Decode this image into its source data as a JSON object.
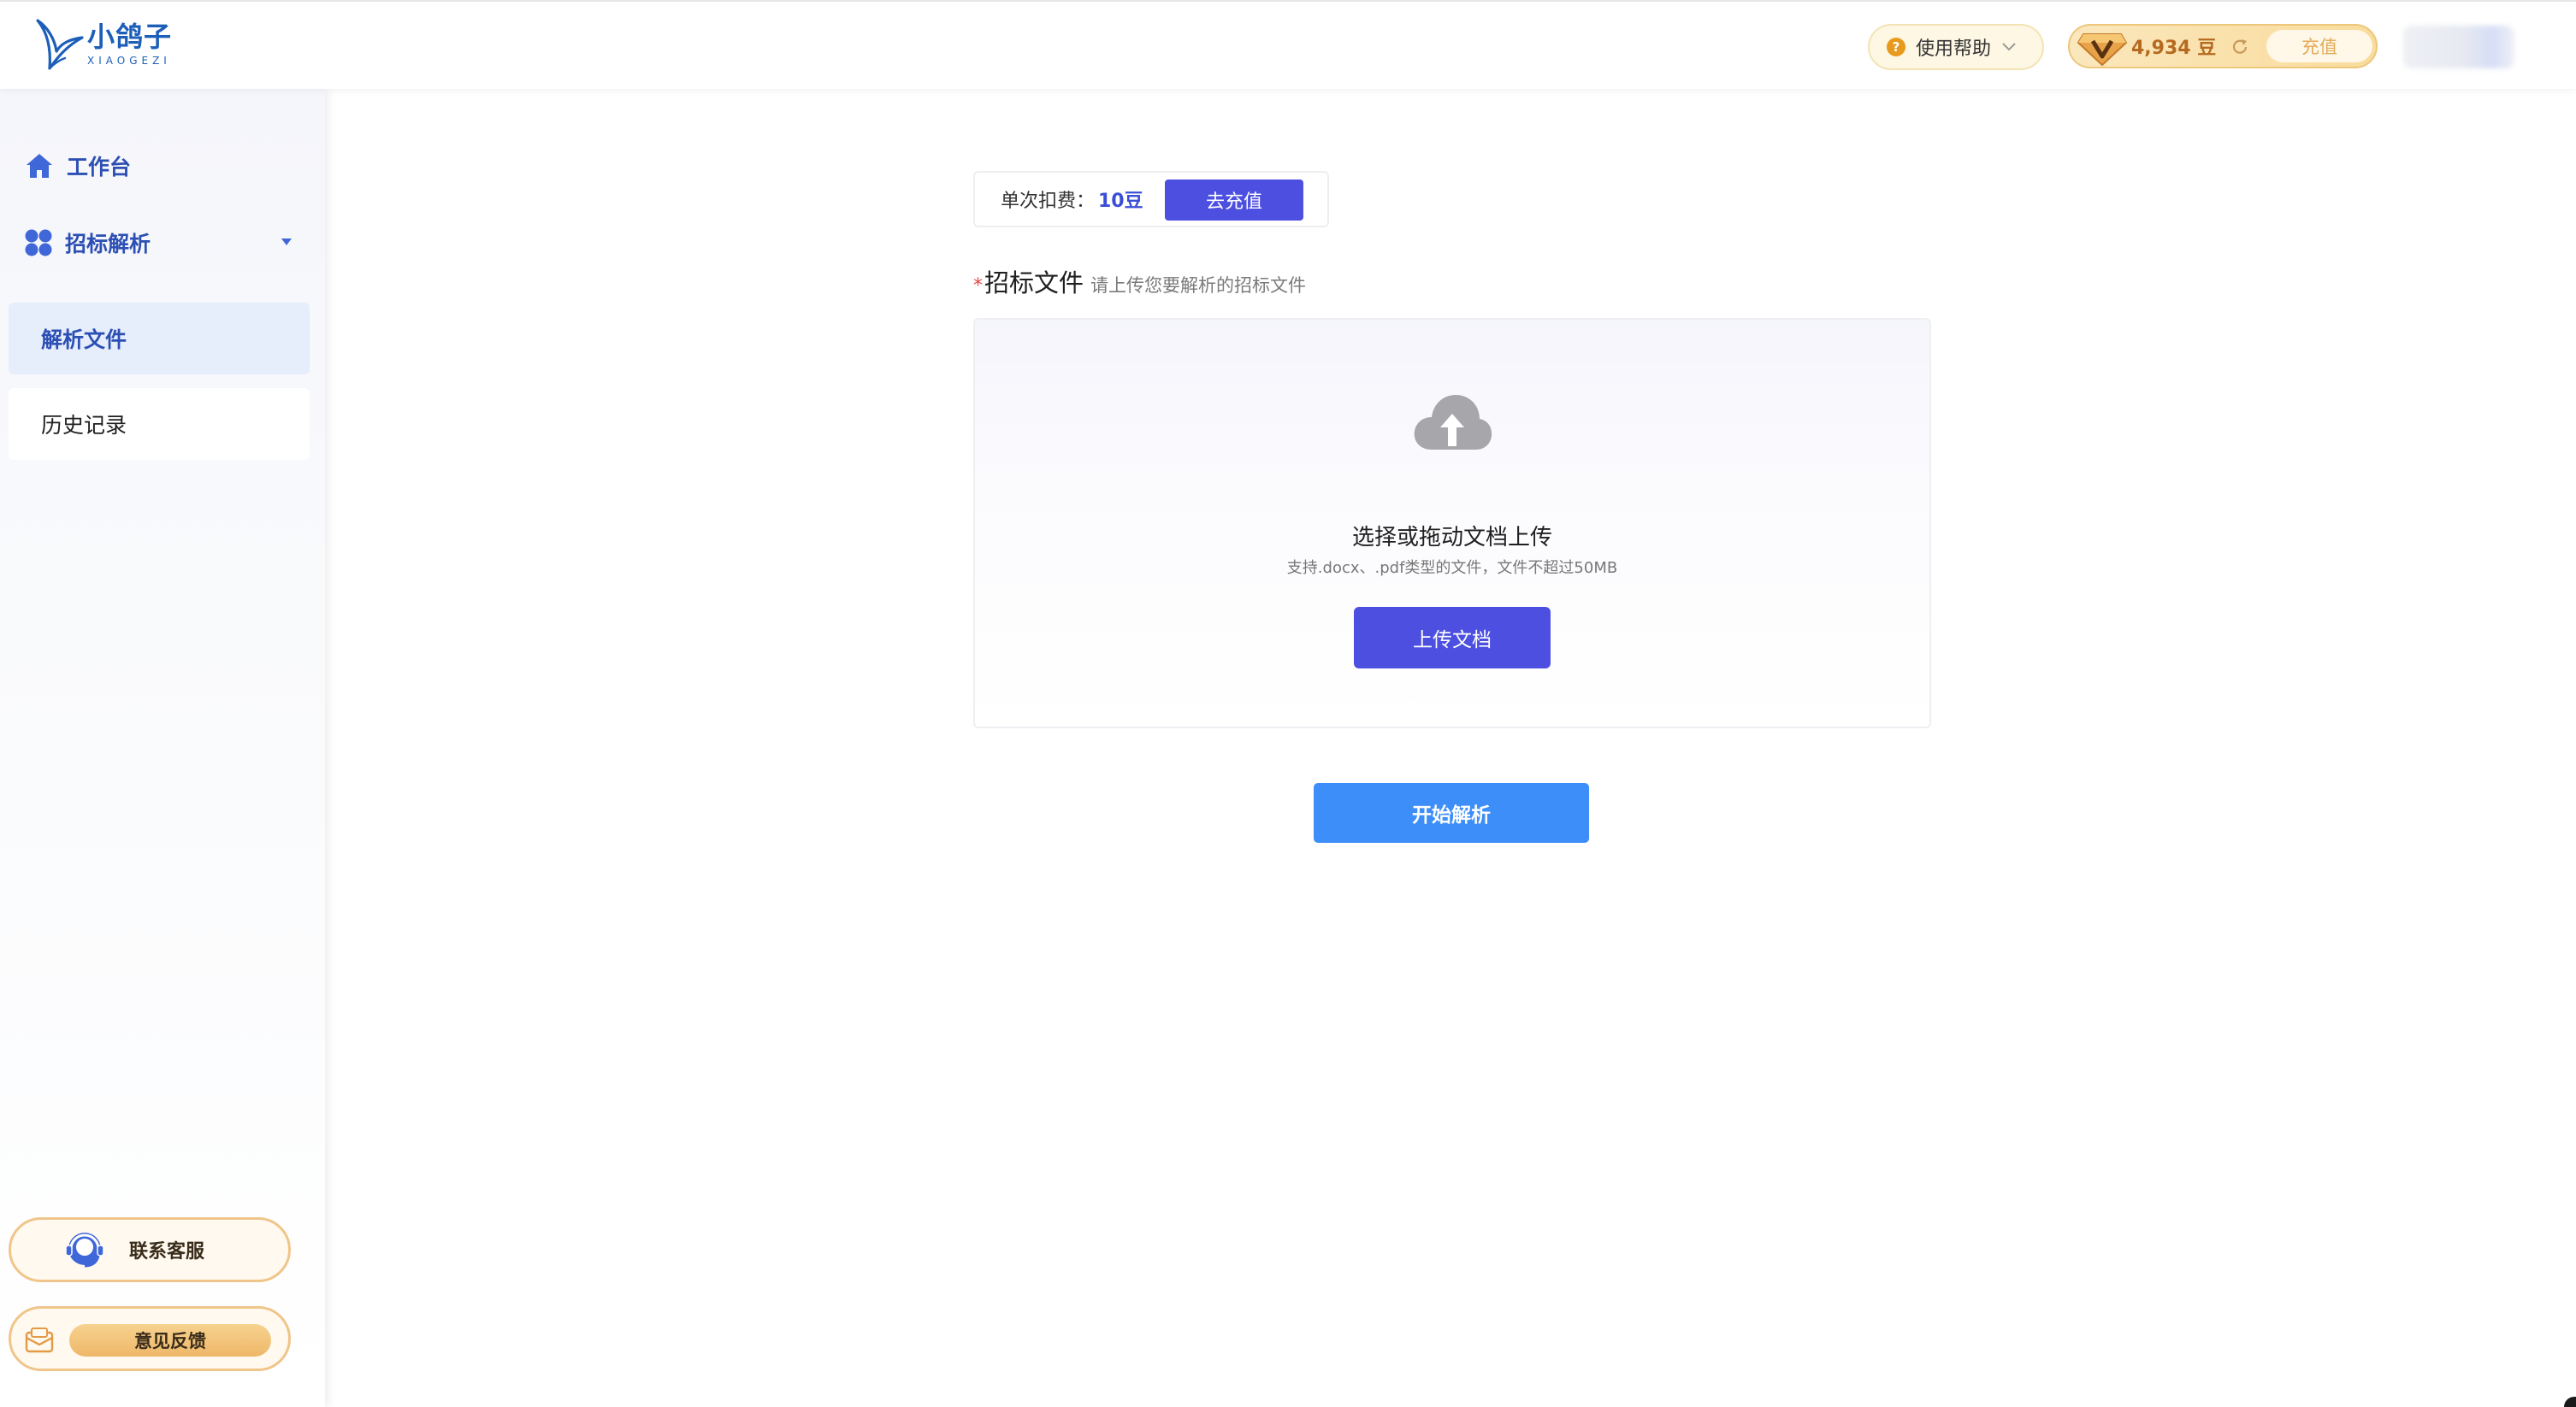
{
  "header": {
    "logo": {
      "name_cn": "小鸽子",
      "name_en": "XIAOGEZI",
      "icon": "bird-logo-icon"
    },
    "help": {
      "label": "使用帮助",
      "icon": "question-circle-icon"
    },
    "balance": {
      "count": "4,934 豆",
      "recharge_label": "充值",
      "icon": "diamond-v-icon"
    }
  },
  "sidebar": {
    "items": [
      {
        "label": "工作台",
        "icon": "home-icon"
      },
      {
        "label": "招标解析",
        "icon": "grid-icon",
        "expanded": true,
        "children": [
          {
            "label": "解析文件",
            "active": true
          },
          {
            "label": "历史记录",
            "active": false
          }
        ]
      }
    ],
    "contact_label": "联系客服",
    "feedback_label": "意见反馈"
  },
  "main": {
    "cost_label": "单次扣费：",
    "cost_value": "10豆",
    "goto_recharge_label": "去充值",
    "file_title": "招标文件",
    "file_hint": "请上传您要解析的招标文件",
    "upload": {
      "title": "选择或拖动文档上传",
      "subtitle": "支持.docx、.pdf类型的文件，文件不超过50MB",
      "button_label": "上传文档"
    },
    "start_label": "开始解析"
  },
  "colors": {
    "primary": "#4c4fe0",
    "accent_blue": "#3d8ef8",
    "nav_text": "#2c4fb3",
    "gold": "#eeb768",
    "required": "#e34848"
  }
}
